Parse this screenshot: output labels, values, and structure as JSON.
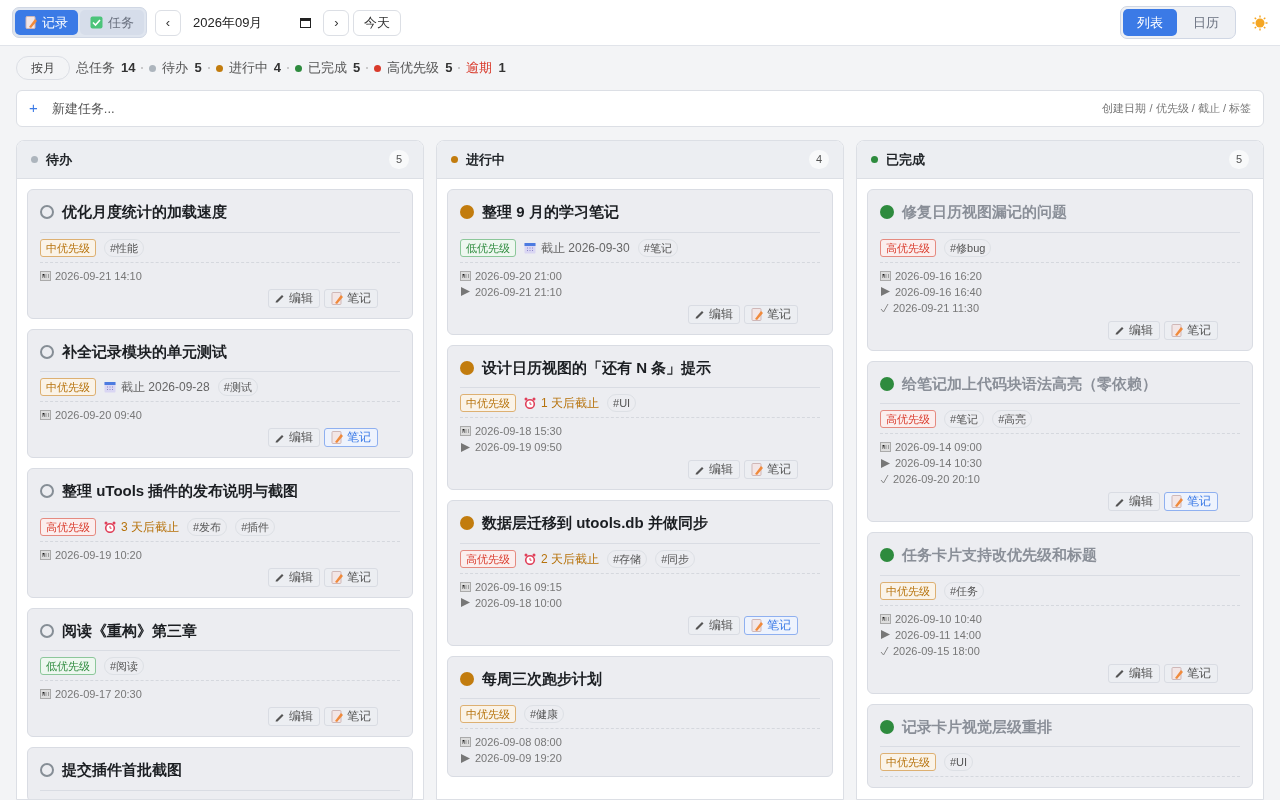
{
  "toolbar": {
    "modes": [
      {
        "label": "记录",
        "kind": "note",
        "selected": true
      },
      {
        "label": "任务",
        "kind": "checkbox",
        "selected": false
      }
    ],
    "prev": "‹",
    "month": "2026年09月",
    "next": "›",
    "today": "今天",
    "views": [
      {
        "label": "列表",
        "selected": true
      },
      {
        "label": "日历",
        "selected": false
      }
    ]
  },
  "stats": {
    "range": "按月",
    "items": [
      {
        "kind": "plain",
        "label": "总任务",
        "count": "14"
      },
      {
        "kind": "dot",
        "label": "待办",
        "count": "5",
        "color": "#adb5bd"
      },
      {
        "kind": "dot",
        "label": "进行中",
        "count": "4",
        "color": "#c27c0e"
      },
      {
        "kind": "dot",
        "label": "已完成",
        "count": "5",
        "color": "#2e8b3e"
      },
      {
        "kind": "dot",
        "label": "高优先级",
        "count": "5",
        "color": "#d93a2b"
      },
      {
        "kind": "alert",
        "label": "逾期",
        "count": "1"
      }
    ]
  },
  "new_task": {
    "plus": "+",
    "placeholder": "新建任务...",
    "hint": "创建日期 / 优先级 / 截止 / 标签"
  },
  "columns": [
    {
      "title": "待办",
      "kind": "todo",
      "color": "#adb5bd",
      "count": "5",
      "cards": [
        {
          "title": "优化月度统计的加载速度",
          "priority": {
            "label": "中优先级",
            "kind": "medium"
          },
          "tags": [
            "#性能"
          ],
          "times": [
            {
              "kind": "created",
              "text": "2026-09-21 14:10"
            }
          ],
          "buttons": {
            "edit": "编辑",
            "note": "笔记",
            "has_note": false
          }
        },
        {
          "title": "补全记录模块的单元测试",
          "priority": {
            "label": "中优先级",
            "kind": "medium"
          },
          "deadline": {
            "kind": "date",
            "text": "截止 2026-09-28"
          },
          "tags": [
            "#测试"
          ],
          "times": [
            {
              "kind": "created",
              "text": "2026-09-20 09:40"
            }
          ],
          "buttons": {
            "edit": "编辑",
            "note": "笔记",
            "has_note": true
          }
        },
        {
          "title": "整理 uTools 插件的发布说明与截图",
          "priority": {
            "label": "高优先级",
            "kind": "high"
          },
          "deadline": {
            "kind": "countdown",
            "text": "3 天后截止"
          },
          "tags": [
            "#发布",
            "#插件"
          ],
          "times": [
            {
              "kind": "created",
              "text": "2026-09-19 10:20"
            }
          ],
          "buttons": {
            "edit": "编辑",
            "note": "笔记",
            "has_note": false
          }
        },
        {
          "title": "阅读《重构》第三章",
          "priority": {
            "label": "低优先级",
            "kind": "low"
          },
          "tags": [
            "#阅读"
          ],
          "times": [
            {
              "kind": "created",
              "text": "2026-09-17 20:30"
            }
          ],
          "buttons": {
            "edit": "编辑",
            "note": "笔记",
            "has_note": false
          }
        },
        {
          "title": "提交插件首批截图"
        }
      ]
    },
    {
      "title": "进行中",
      "kind": "doing",
      "color": "#c27c0e",
      "count": "4",
      "cards": [
        {
          "title": "整理 9 月的学习笔记",
          "priority": {
            "label": "低优先级",
            "kind": "low"
          },
          "deadline": {
            "kind": "date",
            "text": "截止 2026-09-30"
          },
          "tags": [
            "#笔记"
          ],
          "times": [
            {
              "kind": "created",
              "text": "2026-09-20 21:00"
            },
            {
              "kind": "started",
              "text": "2026-09-21 21:10"
            }
          ],
          "buttons": {
            "edit": "编辑",
            "note": "笔记",
            "has_note": false
          }
        },
        {
          "title": "设计日历视图的「还有 N 条」提示",
          "priority": {
            "label": "中优先级",
            "kind": "medium"
          },
          "deadline": {
            "kind": "countdown",
            "text": "1 天后截止"
          },
          "tags": [
            "#UI"
          ],
          "times": [
            {
              "kind": "created",
              "text": "2026-09-18 15:30"
            },
            {
              "kind": "started",
              "text": "2026-09-19 09:50"
            }
          ],
          "buttons": {
            "edit": "编辑",
            "note": "笔记",
            "has_note": false
          }
        },
        {
          "title": "数据层迁移到 utools.db 并做同步",
          "priority": {
            "label": "高优先级",
            "kind": "high"
          },
          "deadline": {
            "kind": "countdown",
            "text": "2 天后截止"
          },
          "tags": [
            "#存储",
            "#同步"
          ],
          "times": [
            {
              "kind": "created",
              "text": "2026-09-16 09:15"
            },
            {
              "kind": "started",
              "text": "2026-09-18 10:00"
            }
          ],
          "buttons": {
            "edit": "编辑",
            "note": "笔记",
            "has_note": true
          }
        },
        {
          "title": "每周三次跑步计划",
          "priority": {
            "label": "中优先级",
            "kind": "medium"
          },
          "tags": [
            "#健康"
          ],
          "times": [
            {
              "kind": "created",
              "text": "2026-09-08 08:00"
            },
            {
              "kind": "started",
              "text": "2026-09-09 19:20"
            }
          ]
        }
      ]
    },
    {
      "title": "已完成",
      "kind": "done",
      "color": "#2e8b3e",
      "count": "5",
      "cards": [
        {
          "title": "修复日历视图漏记的问题",
          "priority": {
            "label": "高优先级",
            "kind": "high"
          },
          "tags": [
            "#修bug"
          ],
          "times": [
            {
              "kind": "created",
              "text": "2026-09-16 16:20"
            },
            {
              "kind": "started",
              "text": "2026-09-16 16:40"
            },
            {
              "kind": "completed",
              "text": "2026-09-21 11:30"
            }
          ],
          "buttons": {
            "edit": "编辑",
            "note": "笔记",
            "has_note": false
          }
        },
        {
          "title": "给笔记加上代码块语法高亮（零依赖）",
          "priority": {
            "label": "高优先级",
            "kind": "high"
          },
          "tags": [
            "#笔记",
            "#高亮"
          ],
          "times": [
            {
              "kind": "created",
              "text": "2026-09-14 09:00"
            },
            {
              "kind": "started",
              "text": "2026-09-14 10:30"
            },
            {
              "kind": "completed",
              "text": "2026-09-20 20:10"
            }
          ],
          "buttons": {
            "edit": "编辑",
            "note": "笔记",
            "has_note": true
          }
        },
        {
          "title": "任务卡片支持改优先级和标题",
          "priority": {
            "label": "中优先级",
            "kind": "medium"
          },
          "tags": [
            "#任务"
          ],
          "times": [
            {
              "kind": "created",
              "text": "2026-09-10 10:40"
            },
            {
              "kind": "started",
              "text": "2026-09-11 14:00"
            },
            {
              "kind": "completed",
              "text": "2026-09-15 18:00"
            }
          ],
          "buttons": {
            "edit": "编辑",
            "note": "笔记",
            "has_note": false
          }
        },
        {
          "title": "记录卡片视觉层级重排",
          "priority": {
            "label": "中优先级",
            "kind": "medium"
          },
          "tags": [
            "#UI"
          ]
        }
      ]
    }
  ]
}
